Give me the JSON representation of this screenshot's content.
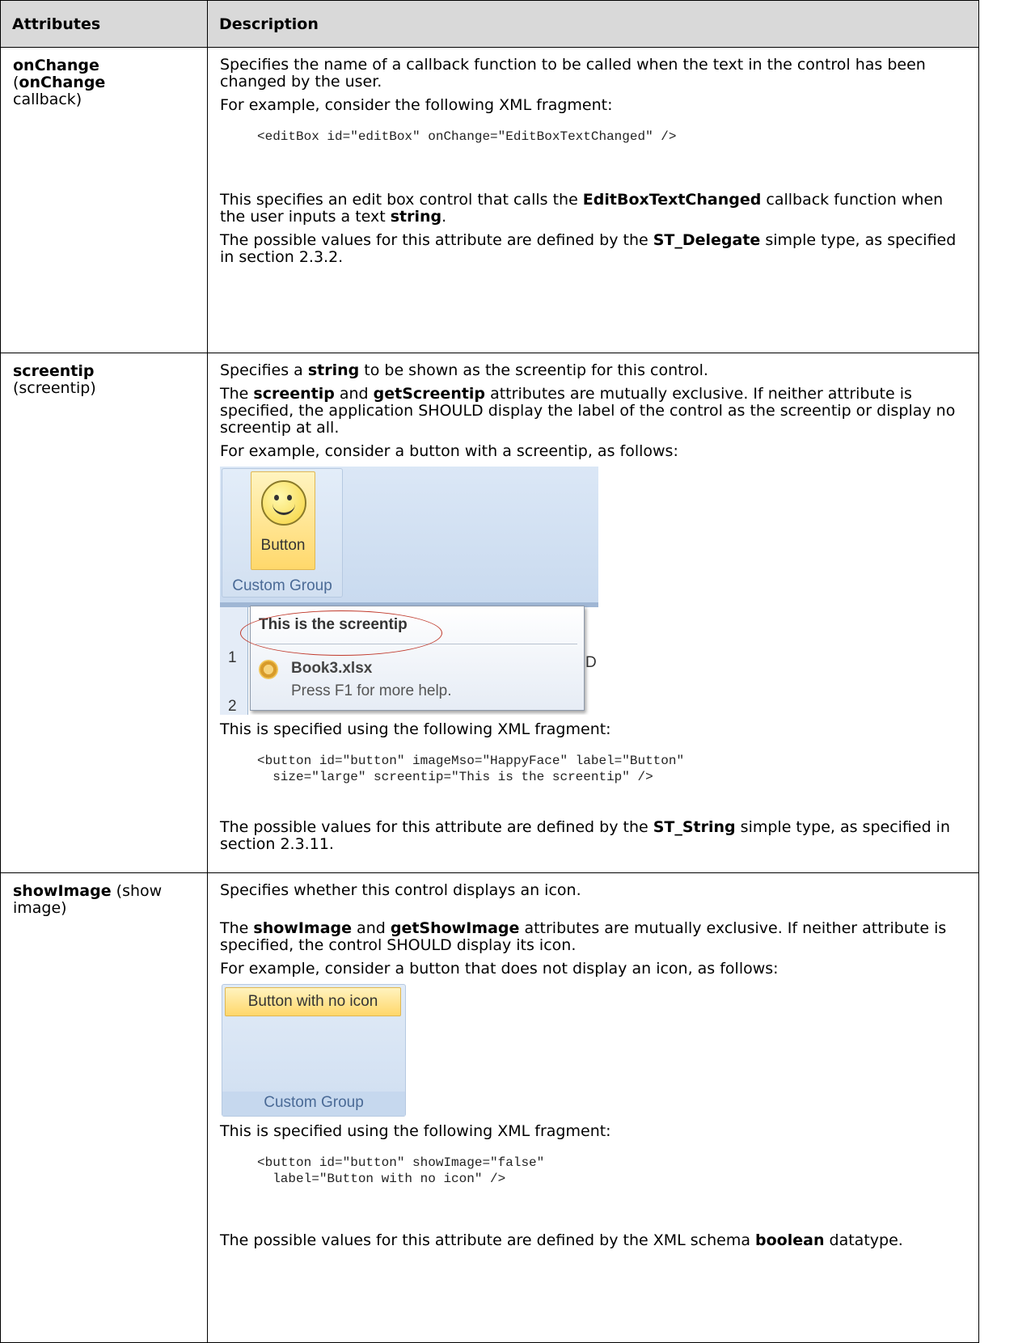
{
  "header": {
    "col1": "Attributes",
    "col2": "Description"
  },
  "rows": [
    {
      "name_bold": "onChange",
      "name_open": "(",
      "name_bold2": "onChange",
      "name_rest": "callback)",
      "p1": "Specifies the name of a callback function to be called when the text in the control has been changed by the user.",
      "p2": "For example, consider the following XML fragment:",
      "code": "<editBox id=\"editBox\" onChange=\"EditBoxTextChanged\" />",
      "p3a": "This specifies an edit box control that calls the ",
      "p3b": "EditBoxTextChanged",
      "p3c": " callback function when the user inputs a text ",
      "p3d": "string",
      "p3e": ".",
      "p4a": "The possible values for this attribute are defined by the ",
      "p4b": "ST_Delegate",
      "p4c": " simple type, as specified in section 2.3.2."
    },
    {
      "name_bold": "screentip",
      "name_rest": "(screentip)",
      "p1a": "Specifies a ",
      "p1b": "string",
      "p1c": " to be shown as the screentip for this control.",
      "p2a": "The ",
      "p2b": "screentip",
      "p2c": " and ",
      "p2d": "getScreentip",
      "p2e": " attributes are mutually exclusive. If neither attribute is specified, the application SHOULD display the label of the control as the screentip or display no screentip at all.",
      "p3": "For example, consider a button with a screentip, as follows:",
      "shot": {
        "button_label": "Button",
        "group_label": "Custom Group",
        "tip_title": "This is the screentip",
        "tip_file": "Book3.xlsx",
        "tip_help": "Press F1 for more help.",
        "row1": "1",
        "row2": "2",
        "col_partial": "D"
      },
      "p4": "This is specified using the following XML fragment:",
      "code": "<button id=\"button\" imageMso=\"HappyFace\" label=\"Button\"\n  size=\"large\" screentip=\"This is the screentip\" />",
      "p5a": "The possible values for this attribute are defined by the ",
      "p5b": "ST_String",
      "p5c": " simple type, as specified in section 2.3.11."
    },
    {
      "name_bold": "showImage",
      "name_rest": " (show image)",
      "p1": "Specifies whether this control displays an icon.",
      "p2a": "The ",
      "p2b": "showImage",
      "p2c": " and ",
      "p2d": "getShowImage",
      "p2e": " attributes are mutually exclusive. If neither attribute is specified, the control SHOULD display its icon.",
      "p3": "For example, consider a button that does not display an icon, as follows:",
      "shot": {
        "button_label": "Button with no icon",
        "group_label": "Custom Group"
      },
      "p4": "This is specified using the following XML fragment:",
      "code": "<button id=\"button\" showImage=\"false\"\n  label=\"Button with no icon\" />",
      "p5a": "The possible values for this attribute are defined by the XML schema ",
      "p5b": "boolean",
      "p5c": " datatype."
    }
  ]
}
